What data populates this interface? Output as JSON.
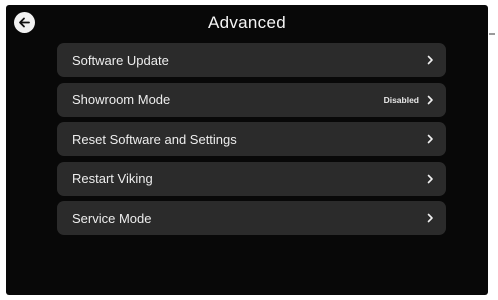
{
  "header": {
    "title": "Advanced",
    "back_icon": "back-arrow-icon"
  },
  "menu": {
    "items": [
      {
        "label": "Software Update",
        "value": ""
      },
      {
        "label": "Showroom Mode",
        "value": "Disabled"
      },
      {
        "label": "Reset Software and Settings",
        "value": ""
      },
      {
        "label": "Restart Viking",
        "value": ""
      },
      {
        "label": "Service Mode",
        "value": ""
      }
    ],
    "chevron_icon": "chevron-right-icon"
  },
  "colors": {
    "background": "#080808",
    "item_background": "#2b2b2b",
    "text": "#ededed"
  }
}
